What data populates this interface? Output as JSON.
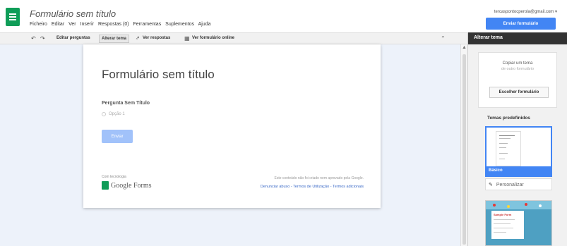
{
  "header": {
    "doc_title": "Formulário sem título",
    "account": "tercaspontocperola@gmail.com ▾",
    "send_label": "Enviar formulário",
    "menu": [
      "Ficheiro",
      "Editar",
      "Ver",
      "Inserir",
      "Respostas (0)",
      "Ferramentas",
      "Suplementos",
      "Ajuda"
    ]
  },
  "toolbar": {
    "undo_icon": "undo-icon",
    "redo_icon": "redo-icon",
    "edit_questions": "Editar perguntas",
    "change_theme": "Alterar tema",
    "view_responses": "Ver respostas",
    "view_online": "Ver formulário online"
  },
  "form": {
    "title": "Formulário sem título",
    "question_title": "Pergunta Sem Título",
    "option_1": "Opção 1",
    "submit_label": "Enviar",
    "powered_by": "Com tecnologia",
    "brand": "Google Forms",
    "disclaimer": "Este conteúdo não foi criado nem aprovado pela Google.",
    "links": [
      "Denunciar abuso",
      "Termos de Utilização",
      "Termos adicionais"
    ]
  },
  "side_panel": {
    "header": "Alterar tema",
    "copy_title": "Copiar um tema",
    "copy_sub": "de outro formulário",
    "choose_label": "Escolher formulário",
    "predefined_label": "Temas predefinidos",
    "theme_selected": "Básico",
    "customize_label": "Personalizar",
    "theme2_title": "Sample Form"
  },
  "colors": {
    "brand_green": "#0f9d58",
    "accent_blue": "#4285f4",
    "canvas_bg": "#edf2fa"
  }
}
